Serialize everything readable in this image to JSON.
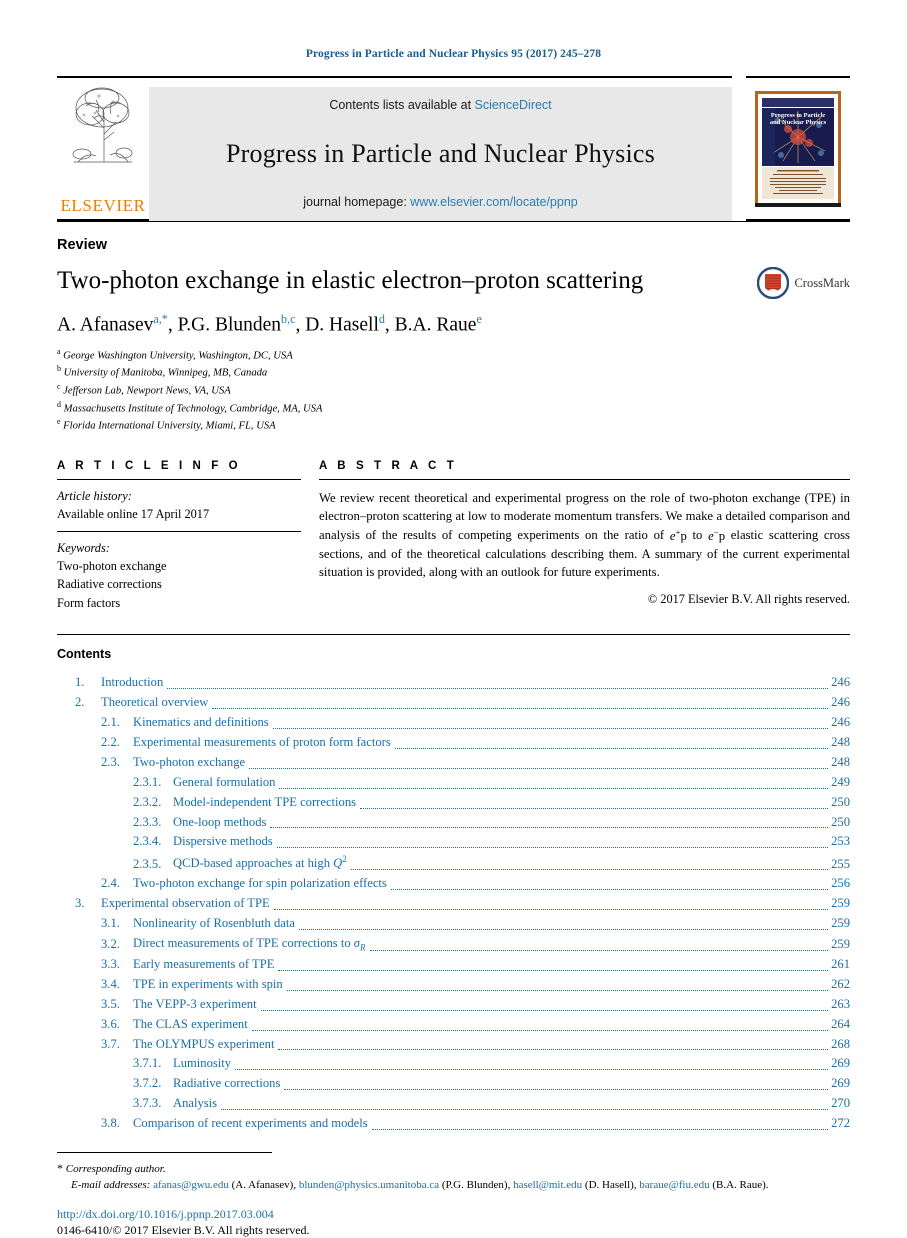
{
  "running_head": "Progress in Particle and Nuclear Physics 95 (2017) 245–278",
  "masthead": {
    "publisher_name": "ELSEVIER",
    "contents_prefix": "Contents lists available at ",
    "sciencedirect": "ScienceDirect",
    "journal_title": "Progress in Particle and Nuclear Physics",
    "homepage_prefix": "journal homepage: ",
    "homepage_url": "www.elsevier.com/locate/ppnp",
    "cover_title_line1": "Progress in Particle",
    "cover_title_line2": "and Nuclear Physics"
  },
  "article": {
    "type_label": "Review",
    "title": "Two-photon exchange in elastic electron–proton scattering",
    "crossmark_label": "CrossMark",
    "authors": [
      {
        "name": "A. Afanasev",
        "marks": "a,*"
      },
      {
        "name": "P.G. Blunden",
        "marks": "b,c"
      },
      {
        "name": "D. Hasell",
        "marks": "d"
      },
      {
        "name": "B.A. Raue",
        "marks": "e"
      }
    ],
    "affiliations": [
      {
        "mark": "a",
        "text": "George Washington University, Washington, DC, USA"
      },
      {
        "mark": "b",
        "text": "University of Manitoba, Winnipeg, MB, Canada"
      },
      {
        "mark": "c",
        "text": "Jefferson Lab, Newport News, VA, USA"
      },
      {
        "mark": "d",
        "text": "Massachusetts Institute of Technology, Cambridge, MA, USA"
      },
      {
        "mark": "e",
        "text": "Florida International University, Miami, FL, USA"
      }
    ]
  },
  "article_info": {
    "heading": "A R T I C L E    I N F O",
    "history_label": "Article history:",
    "history_value": "Available online 17 April 2017",
    "keywords_label": "Keywords:",
    "keywords": [
      "Two-photon exchange",
      "Radiative corrections",
      "Form factors"
    ]
  },
  "abstract": {
    "heading": "A B S T R A C T",
    "text_part1": "We review recent theoretical and experimental progress on the role of two-photon exchange (TPE) in electron–proton scattering at low to moderate momentum transfers. We make a detailed comparison and analysis of the results of competing experiments on the ratio of ",
    "text_part2": " elastic scattering cross sections, and of the theoretical calculations describing them. A summary of the current experimental situation is provided, along with an outlook for future experiments.",
    "inline_formula": "e+p to e−p",
    "copyright": "© 2017 Elsevier B.V. All rights reserved."
  },
  "contents": {
    "heading": "Contents",
    "entries": [
      {
        "level": 1,
        "num": "1.",
        "label": "Introduction",
        "page": "246"
      },
      {
        "level": 1,
        "num": "2.",
        "label": "Theoretical overview",
        "page": "246"
      },
      {
        "level": 2,
        "num": "2.1.",
        "label": "Kinematics and definitions",
        "page": "246"
      },
      {
        "level": 2,
        "num": "2.2.",
        "label": "Experimental measurements of proton form factors",
        "page": "248"
      },
      {
        "level": 2,
        "num": "2.3.",
        "label": "Two-photon exchange",
        "page": "248"
      },
      {
        "level": 3,
        "num": "2.3.1.",
        "label": "General formulation",
        "page": "249"
      },
      {
        "level": 3,
        "num": "2.3.2.",
        "label": "Model-independent TPE corrections",
        "page": "250"
      },
      {
        "level": 3,
        "num": "2.3.3.",
        "label": "One-loop methods",
        "page": "250"
      },
      {
        "level": 3,
        "num": "2.3.4.",
        "label": "Dispersive methods",
        "page": "253"
      },
      {
        "level": 3,
        "num": "2.3.5.",
        "label": "QCD-based approaches at high Q2",
        "page": "255",
        "math": "Q2"
      },
      {
        "level": 2,
        "num": "2.4.",
        "label": "Two-photon exchange for spin polarization effects",
        "page": "256"
      },
      {
        "level": 1,
        "num": "3.",
        "label": "Experimental observation of TPE",
        "page": "259"
      },
      {
        "level": 2,
        "num": "3.1.",
        "label": "Nonlinearity of Rosenbluth data",
        "page": "259"
      },
      {
        "level": 2,
        "num": "3.2.",
        "label": "Direct measurements of TPE corrections to σR",
        "page": "259",
        "math": "sigmaR"
      },
      {
        "level": 2,
        "num": "3.3.",
        "label": "Early measurements of TPE",
        "page": "261"
      },
      {
        "level": 2,
        "num": "3.4.",
        "label": "TPE in experiments with spin",
        "page": "262"
      },
      {
        "level": 2,
        "num": "3.5.",
        "label": "The VEPP-3 experiment",
        "page": "263"
      },
      {
        "level": 2,
        "num": "3.6.",
        "label": "The CLAS experiment",
        "page": "264"
      },
      {
        "level": 2,
        "num": "3.7.",
        "label": "The OLYMPUS experiment",
        "page": "268"
      },
      {
        "level": 3,
        "num": "3.7.1.",
        "label": "Luminosity",
        "page": "269"
      },
      {
        "level": 3,
        "num": "3.7.2.",
        "label": "Radiative corrections",
        "page": "269"
      },
      {
        "level": 3,
        "num": "3.7.3.",
        "label": "Analysis",
        "page": "270"
      },
      {
        "level": 2,
        "num": "3.8.",
        "label": "Comparison of recent experiments and models",
        "page": "272"
      }
    ]
  },
  "footer": {
    "corresponding_author": "Corresponding author.",
    "email_label": "E-mail addresses:",
    "emails": [
      {
        "address": "afanas@gwu.edu",
        "owner": "(A. Afanasev)"
      },
      {
        "address": "blunden@physics.umanitoba.ca",
        "owner": "(P.G. Blunden)"
      },
      {
        "address": "hasell@mit.edu",
        "owner": "(D. Hasell)"
      },
      {
        "address": "baraue@fiu.edu",
        "owner": "(B.A. Raue)."
      }
    ],
    "doi": "http://dx.doi.org/10.1016/j.ppnp.2017.03.004",
    "issn_copyright": "0146-6410/© 2017 Elsevier B.V. All rights reserved."
  },
  "colors": {
    "journal_blue": "#1a5d8f",
    "link_blue": "#2c7cb0",
    "toc_blue": "#1a6ea8",
    "elsevier_orange": "#ef7d00",
    "masthead_grey": "#e8e8e8"
  }
}
